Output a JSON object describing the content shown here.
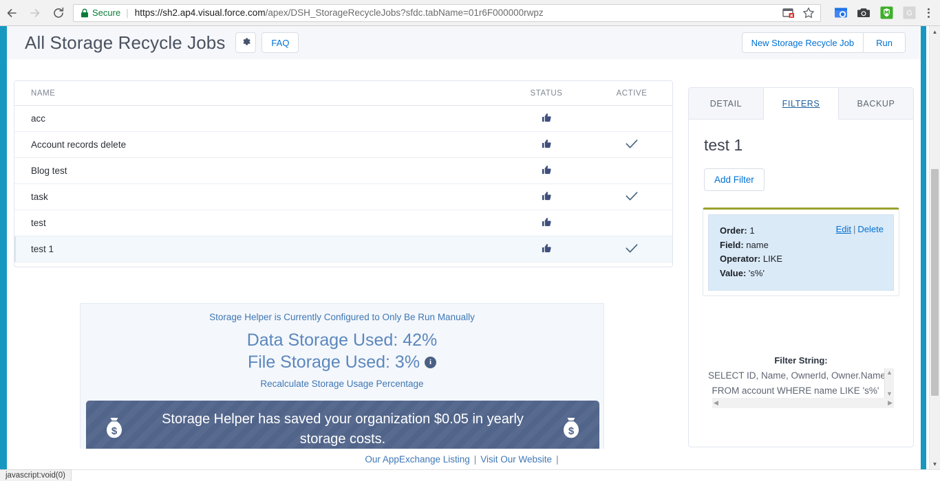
{
  "browser": {
    "back_icon": "arrow-left-icon",
    "forward_icon": "arrow-right-icon",
    "reload_icon": "reload-icon",
    "lock_icon": "lock-icon",
    "secure_label": "Secure",
    "separator": "|",
    "url_host": "https://sh2.ap4.visual.force.com",
    "url_path": "/apex/DSH_StorageRecycleJobs?sfdc.tabName=01r6F000000rwpz",
    "url_full": "https://sh2.ap4.visual.force.com/apex/DSH_StorageRecycleJobs?sfdc.tabName=01r6F000000rwpz",
    "omni_icons": [
      "blocked-popup-icon",
      "bookmark-star-icon"
    ],
    "extensions": [
      "screenshot-capture-icon",
      "camera-icon",
      "malware-shield-icon",
      "google-extension-icon"
    ],
    "menu_icon": "three-dot-menu-icon"
  },
  "header": {
    "title": "All Storage Recycle Jobs",
    "gear_icon": "gear-icon",
    "faq_label": "FAQ",
    "new_job_label": "New Storage Recycle Job",
    "run_label": "Run"
  },
  "jobs_table": {
    "columns": [
      "NAME",
      "STATUS",
      "ACTIVE"
    ],
    "rows": [
      {
        "name": "acc",
        "status_icon": "thumbs-up-icon",
        "active": false,
        "selected": false
      },
      {
        "name": "Account records delete",
        "status_icon": "thumbs-up-icon",
        "active": true,
        "selected": false
      },
      {
        "name": "Blog test",
        "status_icon": "thumbs-up-icon",
        "active": false,
        "selected": false
      },
      {
        "name": "task",
        "status_icon": "thumbs-up-icon",
        "active": true,
        "selected": false
      },
      {
        "name": "test",
        "status_icon": "thumbs-up-icon",
        "active": false,
        "selected": false
      },
      {
        "name": "test 1",
        "status_icon": "thumbs-up-icon",
        "active": true,
        "selected": true
      }
    ]
  },
  "storage": {
    "notice": "Storage Helper is Currently Configured to Only Be Run Manually",
    "data_storage_label": "Data Storage Used: 42%",
    "file_storage_label": "File Storage Used: 3%",
    "data_storage_percent": 42,
    "file_storage_percent": 3,
    "info_icon": "info-icon",
    "info_glyph": "i",
    "recalculate_label": "Recalculate Storage Usage Percentage",
    "savings_text": "Storage Helper has saved your organization $0.05 in yearly storage costs.",
    "savings_amount": "$0.05",
    "bag_icon": "money-bag-icon",
    "banner_color": "#51648a"
  },
  "right_panel": {
    "tabs": [
      {
        "label": "DETAIL",
        "active": false
      },
      {
        "label": "FILTERS",
        "active": true
      },
      {
        "label": "BACKUP",
        "active": false
      }
    ],
    "record_name": "test 1",
    "add_filter_label": "Add Filter",
    "accent_color": "#9aa12c",
    "filter": {
      "order_label": "Order:",
      "order_value": "1",
      "field_label": "Field:",
      "field_value": "name",
      "operator_label": "Operator:",
      "operator_value": "LIKE",
      "value_label": "Value:",
      "value_value": "'s%'",
      "edit_label": "Edit",
      "action_sep": "|",
      "delete_label": "Delete"
    },
    "filter_string_label": "Filter String:",
    "filter_string_line1": "SELECT ID, Name, OwnerId, Owner.Name",
    "filter_string_line2": "FROM account WHERE name LIKE 's%'"
  },
  "footer": {
    "appexchange_label": "Our AppExchange Listing",
    "sep1": "|",
    "website_label": "Visit Our Website",
    "sep2": "|"
  },
  "status_bar": {
    "text": "javascript:void(0)"
  }
}
